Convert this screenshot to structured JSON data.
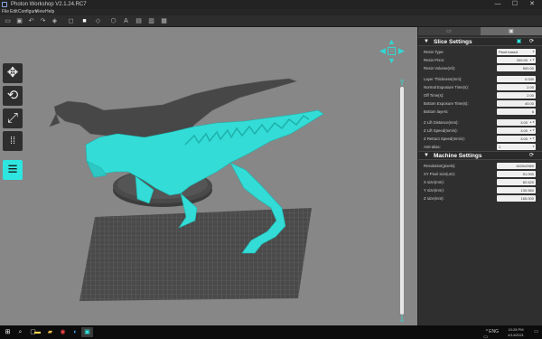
{
  "window": {
    "title": "Photon Workshop V2.1.24.RC7",
    "minimize": "—",
    "maximize": "☐",
    "close": "✕"
  },
  "menu": [
    "File",
    "Edit",
    "Configure",
    "View",
    "Help"
  ],
  "toolbar_icons": [
    "open-file",
    "save",
    "undo",
    "redo",
    "layers",
    "view-front",
    "view-top",
    "view-3d",
    "text",
    "export",
    "export-alt",
    "ruler"
  ],
  "left_tools": {
    "move": "✥",
    "rotate": "⟲",
    "scale": "⤢",
    "arrange": "⁞⁞",
    "slices": "≡"
  },
  "nav": {
    "up": "▲",
    "down": "▼",
    "left": "◀",
    "right": "▶",
    "home": "⌂"
  },
  "layer_slider": {
    "up_arrow": "⇧",
    "down_arrow": "⇩"
  },
  "slice_settings": {
    "title": "Slice Settings",
    "rows": [
      {
        "label": "Resin Type:",
        "value": "Plant based",
        "kind": "dropdown"
      },
      {
        "label": "Resin Price:",
        "value": "200.00",
        "kind": "spinner"
      },
      {
        "label": "Resin Volume(ml):",
        "value": "500.00",
        "kind": "text"
      },
      {
        "label": "Layer Thickness(mm):",
        "value": "0.030",
        "kind": "text"
      },
      {
        "label": "Normal Exposure Time(s):",
        "value": "2.00",
        "kind": "text"
      },
      {
        "label": "Off Time(s):",
        "value": "2.00",
        "kind": "text"
      },
      {
        "label": "Bottom Exposure Time(s):",
        "value": "40.00",
        "kind": "text"
      },
      {
        "label": "Bottom layers:",
        "value": "6",
        "kind": "text"
      },
      {
        "label": "Z Lift Distance(mm):",
        "value": "3.00",
        "kind": "stepper"
      },
      {
        "label": "Z Lift Speed(mm/s):",
        "value": "3.00",
        "kind": "stepper"
      },
      {
        "label": "Z Retract Speed(mm/s):",
        "value": "3.00",
        "kind": "stepper"
      },
      {
        "label": "Anti-alias:",
        "value": "1",
        "kind": "dropdown"
      }
    ]
  },
  "machine_settings": {
    "title": "Machine Settings",
    "rows": [
      {
        "label": "Resolution(pixels):",
        "value": "1620x2560"
      },
      {
        "label": "XY Pixel size(um):",
        "value": "51.000"
      },
      {
        "label": "X size(mm):",
        "value": "82.620"
      },
      {
        "label": "Y size(mm):",
        "value": "130.560"
      },
      {
        "label": "Z size(mm):",
        "value": "165.000"
      }
    ]
  },
  "taskbar": {
    "items": [
      "windows-start",
      "search",
      "task-view",
      "file-explorer",
      "folder",
      "chrome",
      "edge",
      "photon-workshop"
    ]
  },
  "tray": {
    "time": "10:28 PM",
    "date": "4/14/2021",
    "lang": "ENG"
  },
  "colors": {
    "accent": "#2ee6df",
    "model_highlight": "#33dcd6",
    "model_dark": "#474747",
    "viewport_bg": "#878787",
    "platform": "#4a4a4a",
    "panel_bg": "#2f2f2f"
  }
}
